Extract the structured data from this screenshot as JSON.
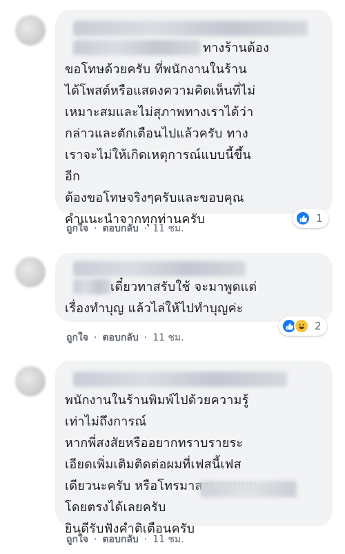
{
  "comments": [
    {
      "text": "ทางร้านต้อง\nขอโทษด้วยครับ ที่พนักงานในร้าน\nได้โพสต์หรือแสดงความคิดเห็นที่ไม่\nเหมาะสมและไม่สุภาพทางเราได้ว่า\nกล่าวและตักเตือนไปแล้วครับ ทาง\nเราจะไม่ให้เกิดเหตุการณ์แบบนี้ขึ้น\nอีก\nต้องขอโทษจริงๆครับและขอบคุณ\nคำแนะนำจากทุกท่านครับ",
      "reaction_count": "1",
      "actions": {
        "like": "ถูกใจ",
        "reply": "ตอบกลับ",
        "time": "11 ชม."
      }
    },
    {
      "text": "เดี๋ยวทาสรับใช้ จะมาพูดแต่\nเรื่องทำบุญ แล้วไล่ให้ไปทำบุญค่ะ",
      "reaction_count": "2",
      "actions": {
        "like": "ถูกใจ",
        "reply": "ตอบกลับ",
        "time": "11 ชม."
      }
    },
    {
      "text": "พนักงานในร้านพิมพ์ไปด้วยความรู้\nเท่าไม่ถึงการณ์\nหากพี่สงสัยหรืออยากทราบรายระ\nเอียดเพิ่มเติมติดต่อผมที่เฟสนี้เฟส\nเดียวนะครับ หรือโทรมาสอบถามผม\nโดยตรงได้เลยครับ\nยินดีรับฟังคำติเตือนครับ",
      "actions": {
        "like": "ถูกใจ",
        "reply": "ตอบกลับ",
        "time": "11 ชม."
      }
    }
  ],
  "separator": "·",
  "icons": {
    "like": "like-icon",
    "haha": "haha-icon"
  },
  "colors": {
    "like_blue": "#1877f2",
    "haha_yellow": "#f7c33c",
    "bubble_bg": "#f2f3f5"
  }
}
